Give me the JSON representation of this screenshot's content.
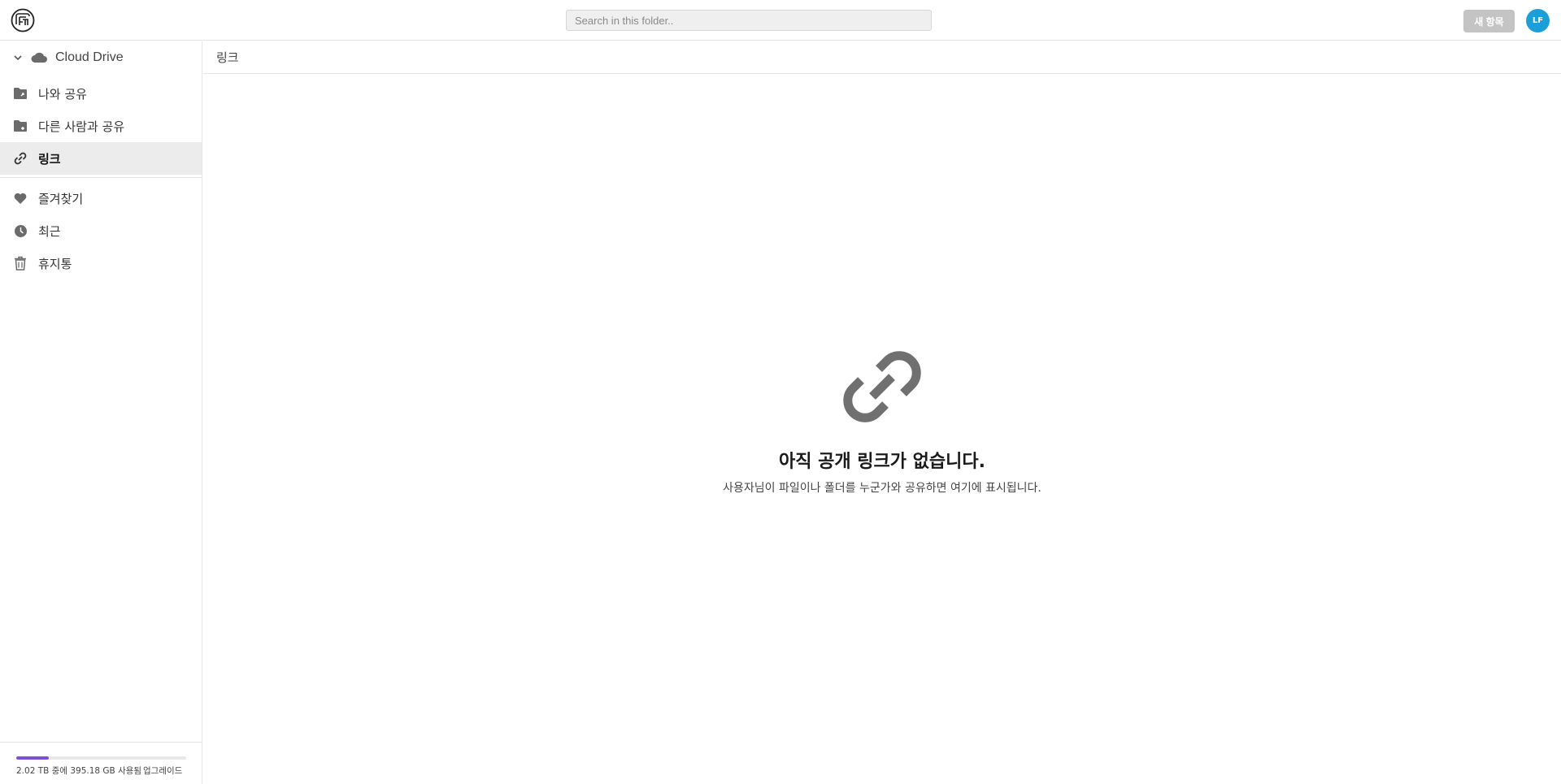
{
  "header": {
    "search_placeholder": "Search in this folder..",
    "new_button": "새 항목",
    "avatar_initials": "LF"
  },
  "sidebar": {
    "root": "Cloud Drive",
    "items": [
      {
        "label": "나와 공유",
        "icon": "shared-folder-icon"
      },
      {
        "label": "다른 사람과 공유",
        "icon": "shared-folder-icon"
      },
      {
        "label": "링크",
        "icon": "link-icon",
        "active": true
      },
      {
        "label": "즐겨찾기",
        "icon": "heart-icon"
      },
      {
        "label": "최근",
        "icon": "clock-icon"
      },
      {
        "label": "휴지통",
        "icon": "trash-icon"
      }
    ],
    "quota": {
      "text": "2.02 TB 중에 395.18 GB 사용됨",
      "used_fraction": 0.19,
      "upgrade": "업그레이드",
      "bar_color": "#7f4fd6"
    }
  },
  "main": {
    "breadcrumb": "링크",
    "empty": {
      "icon": "link-icon",
      "title": "아직 공개 링크가 없습니다.",
      "subtitle": "사용자님이 파일이나 폴더를 누군가와 공유하면 여기에 표시됩니다."
    }
  },
  "colors": {
    "accent": "#1a9fd8",
    "icon_gray": "#6b6b6b"
  }
}
